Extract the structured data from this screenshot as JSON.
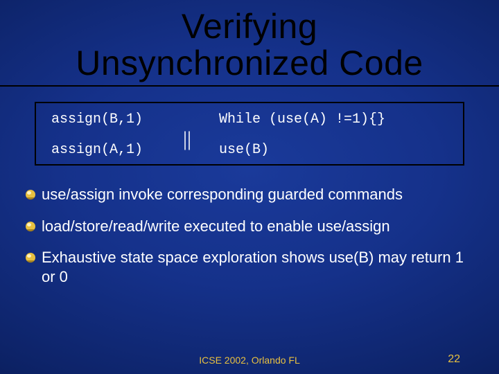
{
  "title_line1": "Verifying",
  "title_line2": "Unsynchronized Code",
  "code": {
    "left1": "assign(B,1)",
    "left2": "assign(A,1)",
    "right1": "While (use(A) !=1){}",
    "right2": "use(B)",
    "parallel": "||"
  },
  "bullets": [
    "use/assign invoke corresponding guarded commands",
    "load/store/read/write executed to enable use/assign",
    "Exhaustive state space exploration shows use(B) may return 1 or 0"
  ],
  "footer": {
    "center": "ICSE 2002, Orlando FL",
    "page": "22"
  }
}
